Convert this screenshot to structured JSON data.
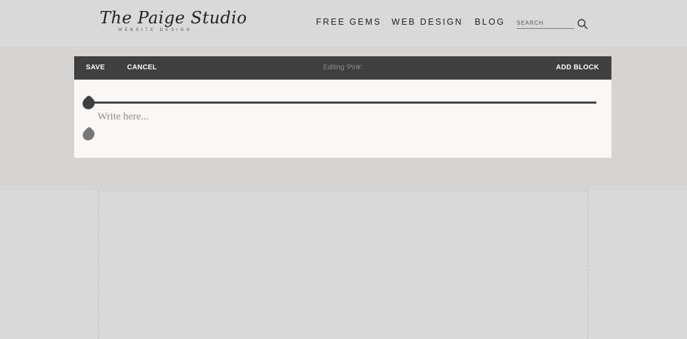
{
  "header": {
    "logo": {
      "script": "The Paige Studio",
      "subtitle": "WEBSITE  DESIGN"
    },
    "nav": [
      "FREE GEMS",
      "WEB DESIGN",
      "BLOG"
    ],
    "search": {
      "placeholder": "SEARCH",
      "icon": "search-icon"
    }
  },
  "toolbar": {
    "save_label": "SAVE",
    "cancel_label": "CANCEL",
    "status": "Editing 'Pink'",
    "add_block_label": "ADD BLOCK",
    "background": "#3f3f3f"
  },
  "editor": {
    "placeholder": "Write here...",
    "background": "#faf7f7"
  },
  "colors": {
    "page": "#d9d9d9",
    "edit_band": "#d6d3d3"
  }
}
